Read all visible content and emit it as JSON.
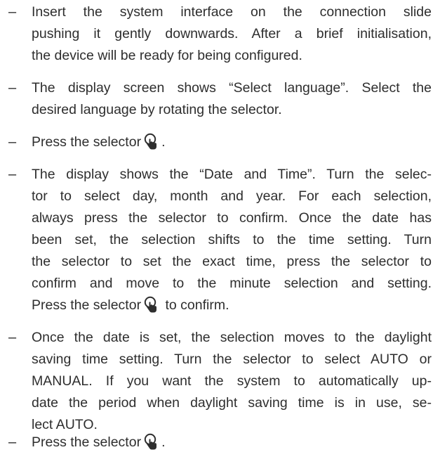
{
  "items": [
    {
      "lines": [
        "Insert the system interface on the connection slide",
        "pushing it gently downwards. After a brief initialisation,",
        "the device will be ready for being configured."
      ]
    },
    {
      "lines": [
        "The display screen shows “Select language”. Select the",
        "desired language by rotating the selector."
      ]
    },
    {
      "lines": [
        "Press the selector"
      ],
      "after_icon": "."
    },
    {
      "lines": [
        "The display shows the “Date and Time”. Turn the selec-",
        "tor to select day, month and year. For each selection,",
        "always press the selector to confirm. Once the date has",
        "been set, the selection shifts to the time setting. Turn",
        "the selector to set the exact time, press the selector to",
        "confirm and move to the minute selection and setting."
      ],
      "last_before_icon": "Press the selector",
      "last_after_icon": "to confirm."
    },
    {
      "lines": [
        "Once the date is set, the selection moves to the daylight",
        "saving time setting. Turn the selector to select AUTO or",
        "MANUAL. If you want the system to automatically up-",
        "date the period when daylight saving time is in use, se-",
        "lect AUTO."
      ]
    },
    {
      "lines": [
        "Press the selector"
      ],
      "after_icon": "."
    }
  ],
  "bullet_char": "–",
  "icon_name": "press-selector-hand-icon",
  "text_color": "#2e2e2e"
}
